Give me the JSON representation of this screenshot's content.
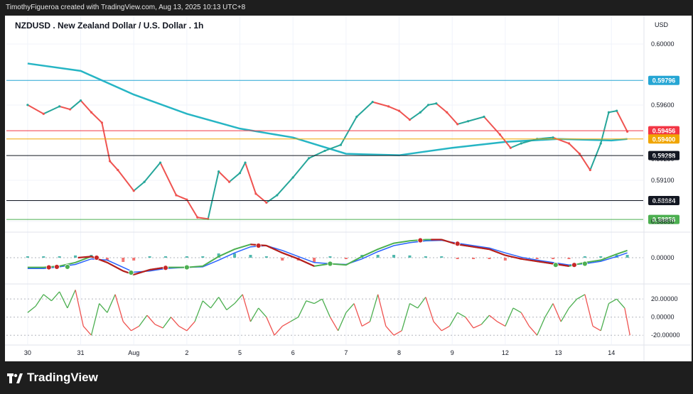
{
  "header": {
    "attribution": "TimothyFigueroa created with TradingView.com, Aug 13, 2025 10:13 UTC+8"
  },
  "footer": {
    "brand": "TradingView"
  },
  "chart_data": [
    {
      "type": "line",
      "title": "NZDUSD . New Zealand Dollar / U.S. Dollar . 1h",
      "currency": "USD",
      "x_labels": [
        "30",
        "31",
        "Aug",
        "2",
        "5",
        "6",
        "7",
        "8",
        "9",
        "12",
        "13",
        "14"
      ],
      "y_ticks": [
        "0.60000",
        "0.59600",
        "0.59250",
        "0.59100",
        "0.58950",
        "0.58850"
      ],
      "ylim": [
        0.5878,
        0.6008
      ],
      "price_series": {
        "name": "",
        "color_up": "#26a69a",
        "color_down": "#ef5350",
        "x": [
          0,
          0.3,
          0.6,
          0.8,
          1.0,
          1.2,
          1.4,
          1.55,
          1.7,
          2.0,
          2.2,
          2.5,
          2.8,
          3.0,
          3.2,
          3.4,
          3.6,
          3.8,
          4.0,
          4.1,
          4.3,
          4.5,
          4.7,
          5.0,
          5.3,
          5.6,
          5.9,
          6.2,
          6.5,
          6.8,
          7.0,
          7.2,
          7.4,
          7.55,
          7.7,
          7.9,
          8.1,
          8.3,
          8.6,
          8.9,
          9.1,
          9.3,
          9.6,
          9.9,
          10.2,
          10.4,
          10.6,
          10.8,
          10.95,
          11.1,
          11.3
        ],
        "values": [
          0.5963,
          0.5957,
          0.5962,
          0.596,
          0.5966,
          0.5958,
          0.5951,
          0.5925,
          0.5919,
          0.5905,
          0.5911,
          0.5924,
          0.5902,
          0.5899,
          0.5887,
          0.5886,
          0.5918,
          0.5911,
          0.5917,
          0.5924,
          0.5903,
          0.5897,
          0.5902,
          0.5914,
          0.5927,
          0.5932,
          0.5936,
          0.5955,
          0.5965,
          0.5962,
          0.5959,
          0.5953,
          0.5958,
          0.5963,
          0.5964,
          0.5958,
          0.595,
          0.5952,
          0.5955,
          0.5943,
          0.5934,
          0.5937,
          0.594,
          0.5941,
          0.5937,
          0.593,
          0.5919,
          0.5937,
          0.5958,
          0.5959,
          0.5945
        ]
      },
      "moving_average": {
        "color": "#26b5c4",
        "x": [
          0,
          1,
          2,
          3,
          4,
          5,
          6,
          7,
          8,
          9,
          10,
          11,
          11.3
        ],
        "values": [
          0.5991,
          0.5986,
          0.597,
          0.5957,
          0.5947,
          0.5941,
          0.593,
          0.5929,
          0.5934,
          0.5938,
          0.594,
          0.5939,
          0.594
        ]
      },
      "levels": [
        {
          "value": 0.59796,
          "label": "0.59796",
          "color": "#26a6d4"
        },
        {
          "value": 0.59456,
          "label": "0.59456",
          "color": "#f23645"
        },
        {
          "value": 0.594,
          "label": "0.59400",
          "color": "#f0a500"
        },
        {
          "value": 0.59288,
          "label": "0.59288",
          "color": "#131722"
        },
        {
          "value": 0.58984,
          "label": "0.58984",
          "color": "#131722"
        },
        {
          "value": 0.58856,
          "label": "0.58856",
          "color": "#4caf50"
        }
      ],
      "grid": true
    },
    {
      "type": "line",
      "panel": "oscillator-1",
      "y_ticks": [
        "0.00000"
      ],
      "ylim": [
        -1,
        1
      ],
      "fast_line": {
        "color": "#4caf50",
        "x": [
          0,
          0.3,
          0.6,
          0.9,
          1.2,
          1.5,
          1.8,
          2.0,
          2.3,
          2.6,
          3.0,
          3.3,
          3.6,
          3.9,
          4.2,
          4.5,
          4.8,
          5.1,
          5.4,
          5.7,
          6.0,
          6.3,
          6.6,
          6.9,
          7.2,
          7.5,
          7.8,
          8.1,
          8.4,
          8.7,
          9.0,
          9.3,
          9.6,
          9.9,
          10.2,
          10.5,
          10.8,
          11.1,
          11.3
        ],
        "values": [
          -0.4,
          -0.4,
          -0.35,
          -0.2,
          0.05,
          -0.2,
          -0.55,
          -0.7,
          -0.5,
          -0.4,
          -0.4,
          -0.35,
          0.05,
          0.35,
          0.55,
          0.5,
          0.2,
          -0.05,
          -0.35,
          -0.25,
          -0.3,
          0.05,
          0.35,
          0.6,
          0.7,
          0.75,
          0.75,
          0.55,
          0.45,
          0.35,
          0.1,
          -0.05,
          -0.15,
          -0.25,
          -0.35,
          -0.2,
          -0.1,
          0.15,
          0.3
        ]
      },
      "slow_line": {
        "color": "#2962ff",
        "x": [
          0,
          0.3,
          0.6,
          0.9,
          1.2,
          1.5,
          1.8,
          2.0,
          2.3,
          2.6,
          3.0,
          3.3,
          3.6,
          3.9,
          4.2,
          4.5,
          4.8,
          5.1,
          5.4,
          5.7,
          6.0,
          6.3,
          6.6,
          6.9,
          7.2,
          7.5,
          7.8,
          8.1,
          8.4,
          8.7,
          9.0,
          9.3,
          9.6,
          9.9,
          10.2,
          10.5,
          10.8,
          11.1,
          11.3
        ],
        "values": [
          -0.45,
          -0.45,
          -0.38,
          -0.28,
          -0.05,
          -0.1,
          -0.4,
          -0.6,
          -0.55,
          -0.45,
          -0.4,
          -0.38,
          -0.1,
          0.2,
          0.45,
          0.5,
          0.3,
          0.05,
          -0.2,
          -0.25,
          -0.28,
          -0.05,
          0.25,
          0.5,
          0.62,
          0.7,
          0.72,
          0.6,
          0.5,
          0.4,
          0.2,
          0.02,
          -0.1,
          -0.2,
          -0.3,
          -0.25,
          -0.15,
          0.05,
          0.2
        ]
      },
      "down_line": {
        "color": "#b71c1c",
        "x": [
          0.95,
          1.2,
          1.5,
          1.8,
          2.0,
          2.3,
          2.6,
          4.2,
          4.5,
          4.8,
          5.1,
          5.4,
          7.6,
          7.8,
          8.1,
          8.4,
          8.7,
          9.0,
          9.3,
          9.6,
          9.9,
          10.2
        ],
        "values": [
          0.0,
          0.05,
          -0.2,
          -0.55,
          -0.7,
          -0.5,
          -0.4,
          0.55,
          0.5,
          0.2,
          -0.05,
          -0.35,
          0.75,
          0.75,
          0.55,
          0.45,
          0.35,
          0.1,
          -0.05,
          -0.15,
          -0.25,
          -0.35
        ]
      },
      "cross_markers": [
        {
          "x": 0.4,
          "value": -0.4,
          "color": "#c62828"
        },
        {
          "x": 0.55,
          "value": -0.38,
          "color": "#c62828"
        },
        {
          "x": 0.75,
          "value": -0.38,
          "color": "#4caf50"
        },
        {
          "x": 1.3,
          "value": 0.0,
          "color": "#c62828"
        },
        {
          "x": 1.95,
          "value": -0.62,
          "color": "#4caf50"
        },
        {
          "x": 2.6,
          "value": -0.42,
          "color": "#c62828"
        },
        {
          "x": 3.0,
          "value": -0.4,
          "color": "#4caf50"
        },
        {
          "x": 4.35,
          "value": 0.5,
          "color": "#c62828"
        },
        {
          "x": 5.7,
          "value": -0.25,
          "color": "#4caf50"
        },
        {
          "x": 7.4,
          "value": 0.72,
          "color": "#c62828"
        },
        {
          "x": 8.1,
          "value": 0.58,
          "color": "#c62828"
        },
        {
          "x": 9.95,
          "value": -0.3,
          "color": "#4caf50"
        },
        {
          "x": 10.3,
          "value": -0.3,
          "color": "#c62828"
        },
        {
          "x": 10.5,
          "value": -0.25,
          "color": "#4caf50"
        }
      ]
    },
    {
      "type": "line",
      "panel": "oscillator-2",
      "y_ticks": [
        "20.00000",
        "0.00000",
        "-20.00000"
      ],
      "ylim": [
        -30,
        35
      ],
      "up_color": "#4caf50",
      "down_color": "#ef5350",
      "x": [
        0,
        0.15,
        0.3,
        0.45,
        0.6,
        0.75,
        0.9,
        1.05,
        1.2,
        1.35,
        1.5,
        1.65,
        1.8,
        1.95,
        2.1,
        2.25,
        2.4,
        2.55,
        2.7,
        2.85,
        3.0,
        3.15,
        3.3,
        3.45,
        3.6,
        3.75,
        3.9,
        4.05,
        4.2,
        4.35,
        4.5,
        4.65,
        4.8,
        4.95,
        5.1,
        5.25,
        5.4,
        5.55,
        5.7,
        5.85,
        6.0,
        6.15,
        6.3,
        6.45,
        6.6,
        6.75,
        6.9,
        7.05,
        7.2,
        7.35,
        7.5,
        7.65,
        7.8,
        7.95,
        8.1,
        8.25,
        8.4,
        8.55,
        8.7,
        8.85,
        9.0,
        9.15,
        9.3,
        9.45,
        9.6,
        9.75,
        9.9,
        10.05,
        10.2,
        10.35,
        10.5,
        10.65,
        10.8,
        10.95,
        11.1,
        11.25,
        11.35
      ],
      "values": [
        5,
        12,
        25,
        18,
        28,
        10,
        30,
        -10,
        -20,
        15,
        5,
        25,
        -5,
        -15,
        -10,
        2,
        -8,
        -12,
        0,
        -10,
        -15,
        -5,
        18,
        10,
        22,
        8,
        15,
        25,
        -5,
        10,
        0,
        -20,
        -10,
        -5,
        0,
        18,
        15,
        20,
        0,
        -15,
        5,
        15,
        -10,
        -5,
        25,
        -10,
        -20,
        -15,
        15,
        10,
        22,
        -5,
        -15,
        -10,
        5,
        0,
        -12,
        -8,
        2,
        -5,
        -10,
        10,
        5,
        -10,
        -20,
        0,
        15,
        -5,
        10,
        20,
        25,
        -10,
        -15,
        15,
        20,
        10,
        -20
      ]
    }
  ]
}
